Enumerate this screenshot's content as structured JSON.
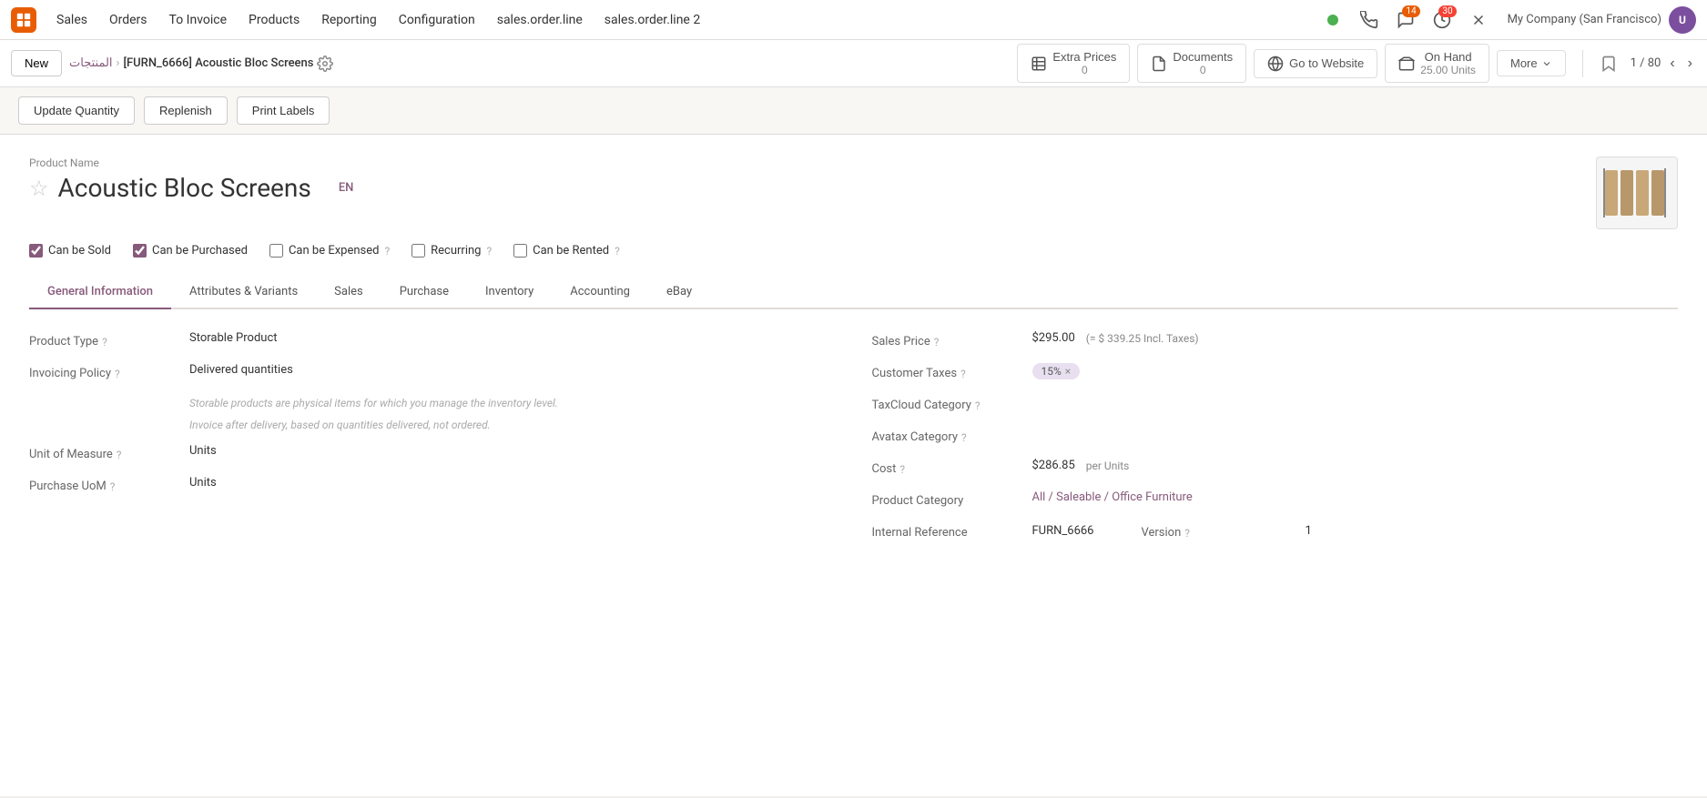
{
  "app": {
    "logo_text": "O",
    "nav_items": [
      "Sales",
      "Orders",
      "To Invoice",
      "Products",
      "Reporting",
      "Configuration"
    ],
    "nav_extra": [
      "sales.order.line",
      "sales.order.line 2"
    ]
  },
  "icons": {
    "chat_count": "14",
    "clock_count": "30",
    "company": "My Company (San Francisco)"
  },
  "breadcrumb": {
    "parent": "المنتجات",
    "current": "[FURN_6666] Acoustic Bloc Screens"
  },
  "actions": {
    "new_label": "New",
    "extra_prices_label": "Extra Prices",
    "extra_prices_count": "0",
    "documents_label": "Documents",
    "documents_count": "0",
    "go_to_website_label": "Go to Website",
    "on_hand_label": "On Hand",
    "on_hand_value": "25.00 Units",
    "more_label": "More",
    "pager": "1 / 80"
  },
  "actionbar": {
    "update_qty_label": "Update Quantity",
    "replenish_label": "Replenish",
    "print_labels_label": "Print Labels"
  },
  "product": {
    "name_label": "Product Name",
    "title": "Acoustic Bloc Screens",
    "en_badge": "EN"
  },
  "checkboxes": {
    "can_be_sold": {
      "label": "Can be Sold",
      "checked": true
    },
    "can_be_purchased": {
      "label": "Can be Purchased",
      "checked": true
    },
    "can_be_expensed": {
      "label": "Can be Expensed",
      "checked": false
    },
    "recurring": {
      "label": "Recurring",
      "checked": false
    },
    "can_be_rented": {
      "label": "Can be Rented",
      "checked": false
    }
  },
  "tabs": [
    {
      "id": "general",
      "label": "General Information",
      "active": true
    },
    {
      "id": "attributes",
      "label": "Attributes & Variants"
    },
    {
      "id": "sales",
      "label": "Sales"
    },
    {
      "id": "purchase",
      "label": "Purchase"
    },
    {
      "id": "inventory",
      "label": "Inventory"
    },
    {
      "id": "accounting",
      "label": "Accounting"
    },
    {
      "id": "ebay",
      "label": "eBay"
    }
  ],
  "general_info": {
    "product_type_label": "Product Type",
    "product_type_value": "Storable Product",
    "invoicing_policy_label": "Invoicing Policy",
    "invoicing_policy_value": "Delivered quantities",
    "hint1": "Storable products are physical items for which you manage the inventory level.",
    "hint2": "Invoice after delivery, based on quantities delivered, not ordered.",
    "unit_of_measure_label": "Unit of Measure",
    "unit_of_measure_value": "Units",
    "purchase_uom_label": "Purchase UoM",
    "purchase_uom_value": "Units",
    "sales_price_label": "Sales Price",
    "sales_price_value": "$295.00",
    "sales_price_incl": "(= $ 339.25 Incl. Taxes)",
    "customer_taxes_label": "Customer Taxes",
    "customer_taxes_value": "15%",
    "taxcloud_label": "TaxCloud Category",
    "taxcloud_value": "",
    "avatax_label": "Avatax Category",
    "avatax_value": "",
    "cost_label": "Cost",
    "cost_value": "$286.85",
    "cost_unit": "per Units",
    "product_category_label": "Product Category",
    "product_category_value": "All / Saleable / Office Furniture",
    "internal_ref_label": "Internal Reference",
    "internal_ref_value": "FURN_6666",
    "version_label": "Version",
    "version_value": "1"
  }
}
